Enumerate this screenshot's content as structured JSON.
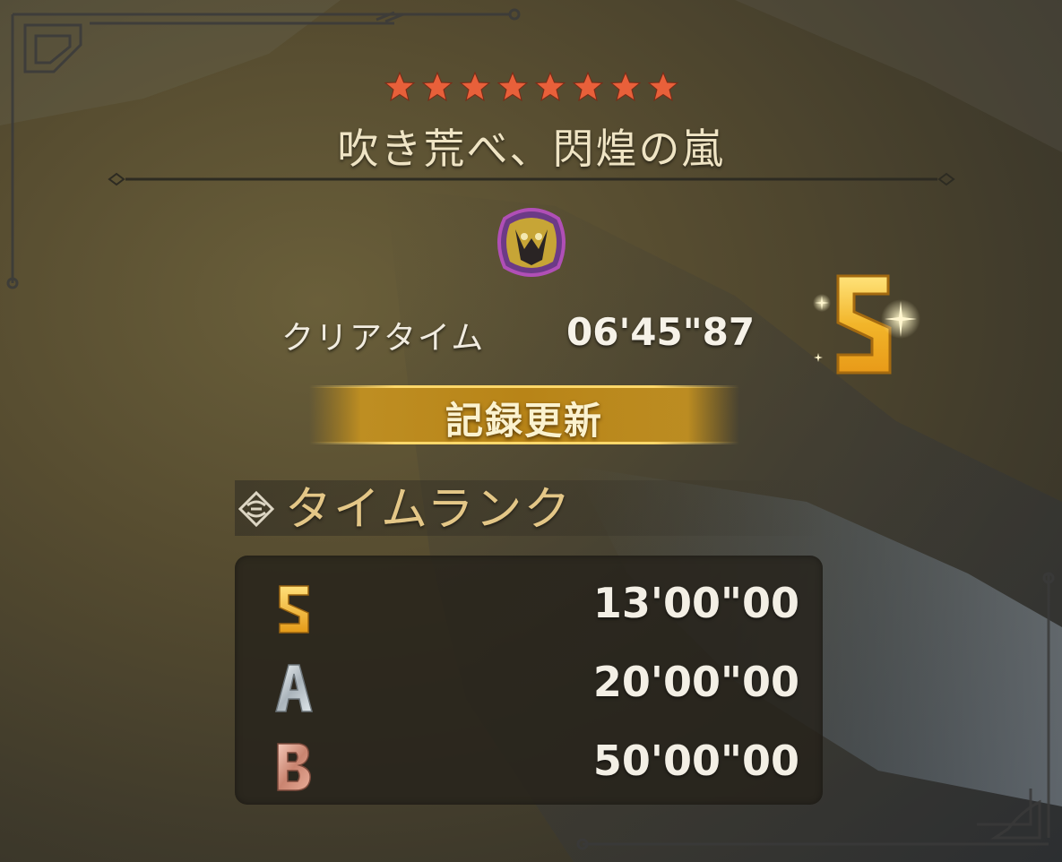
{
  "quest": {
    "star_count": 8,
    "star_color": "#e8603a",
    "title": "吹き荒べ、閃煌の嵐",
    "monster_icon": "monster-face-icon"
  },
  "result": {
    "clear_time_label": "クリアタイム",
    "clear_time_value": "06'45\"87",
    "rank_achieved": "S",
    "record_label": "記録更新"
  },
  "time_rank": {
    "header": "タイムランク",
    "rows": [
      {
        "rank": "S",
        "time": "13'00\"00",
        "color": "#f0b52a"
      },
      {
        "rank": "A",
        "time": "20'00\"00",
        "color": "#c8d0d6"
      },
      {
        "rank": "B",
        "time": "50'00\"00",
        "color": "#d89a86"
      }
    ]
  },
  "colors": {
    "gold": "#e9b73a",
    "title_text": "#efe4c4",
    "section_header": "#e4c787"
  }
}
